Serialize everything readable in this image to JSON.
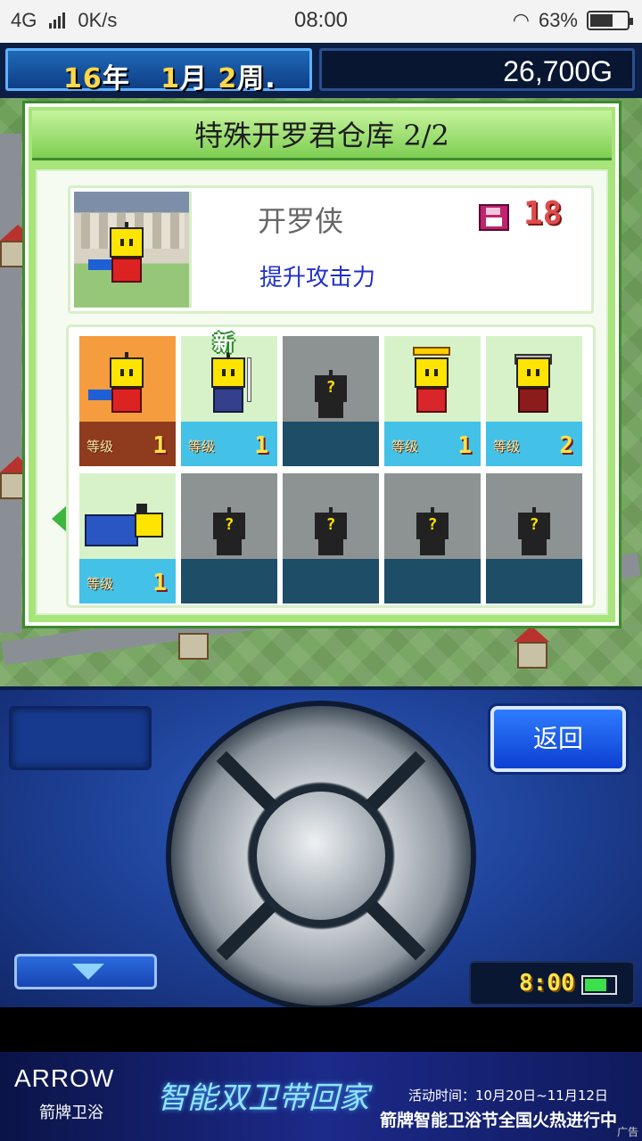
{
  "status_bar": {
    "network": "4G",
    "speed": "0K/s",
    "time": "08:00",
    "battery": "63%",
    "battery_level": 0.63
  },
  "hud": {
    "year_num": "16",
    "year_unit": "年",
    "month_num": "1",
    "month_unit": "月",
    "week_num": "2",
    "week_unit": "周",
    "dot": ".",
    "money": "26,700G"
  },
  "panel": {
    "title": "特殊开罗君仓库 2/2",
    "selected": {
      "name": "开罗侠",
      "count": "18",
      "effect": "提升攻击力"
    },
    "level_label": "等级",
    "new_badge": "新",
    "mystery_mark": "?",
    "slots": [
      {
        "type": "hero",
        "level": "1",
        "selected": true
      },
      {
        "type": "samurai",
        "level": "1",
        "is_new": true
      },
      {
        "type": "empty"
      },
      {
        "type": "king",
        "level": "1"
      },
      {
        "type": "knight",
        "level": "2"
      },
      {
        "type": "train",
        "level": "1"
      },
      {
        "type": "empty"
      },
      {
        "type": "empty"
      },
      {
        "type": "empty"
      },
      {
        "type": "empty"
      }
    ]
  },
  "controller": {
    "back_label": "返回",
    "clock": "8:00",
    "battery_level": 0.75
  },
  "ad": {
    "brand": "ARROW",
    "brand_sub": "箭牌卫浴",
    "slogan": "智能双卫带回家",
    "dates": "活动时间：10月20日~11月12日",
    "headline": "箭牌智能卫浴节全国火热进行中",
    "ad_mark": "广告"
  }
}
